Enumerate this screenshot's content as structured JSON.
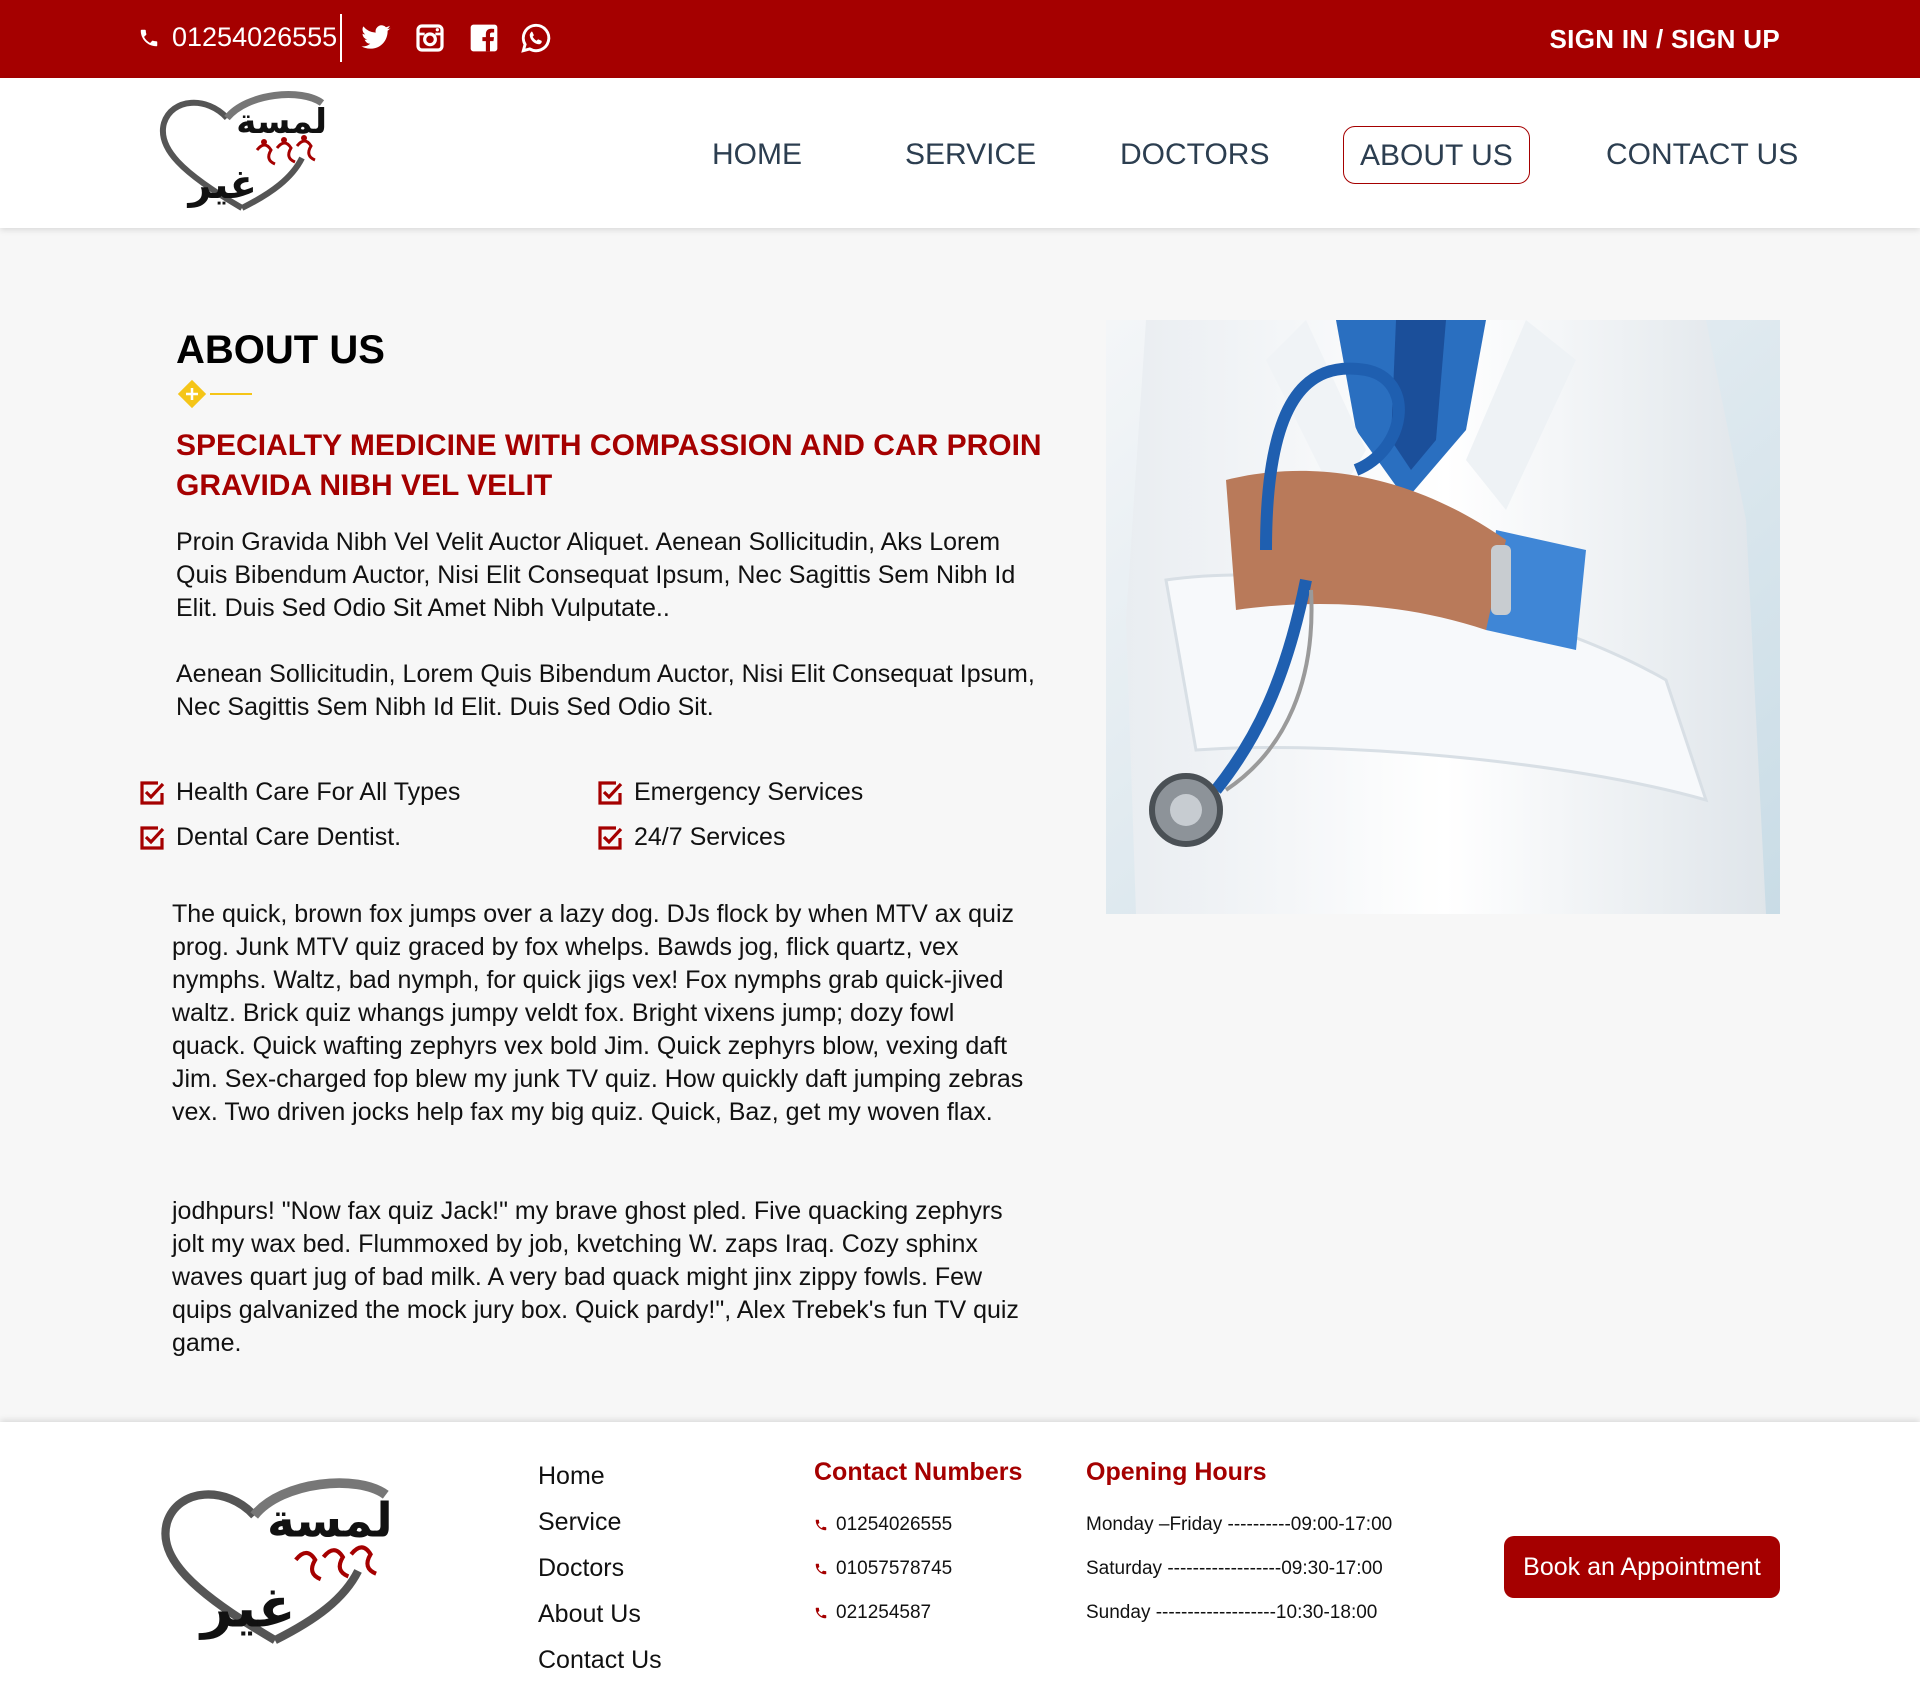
{
  "colors": {
    "brand": "#a50000",
    "accent": "#f5c518",
    "nav_text": "#2c3e50"
  },
  "topbar": {
    "phone": "01254026555",
    "phone_icon": "phone-icon",
    "social_icons": [
      "twitter-icon",
      "instagram-icon",
      "facebook-icon",
      "whatsapp-icon"
    ],
    "auth_label": "SIGN IN / SIGN UP"
  },
  "nav": {
    "items": [
      {
        "label": "HOME"
      },
      {
        "label": "SERVICE"
      },
      {
        "label": "DOCTORS"
      },
      {
        "label": "ABOUT US",
        "active": true
      },
      {
        "label": "CONTACT US"
      }
    ]
  },
  "logo": {
    "text_line1": "لمسة",
    "text_line2": "غير"
  },
  "about": {
    "title": "ABOUT US",
    "subheading": "SPECIALTY MEDICINE WITH COMPASSION AND CAR PROIN GRAVIDA NIBH VEL VELIT",
    "paragraph1": "Proin Gravida Nibh Vel Velit Auctor Aliquet. Aenean Sollicitudin, Aks Lorem Quis Bibendum Auctor, Nisi Elit Consequat Ipsum, Nec Sagittis Sem Nibh Id Elit. Duis Sed Odio Sit Amet Nibh Vulputate..",
    "paragraph2": "Aenean Sollicitudin, Lorem Quis Bibendum Auctor, Nisi Elit Consequat Ipsum, Nec Sagittis Sem Nibh Id Elit. Duis Sed Odio Sit.",
    "features": [
      "Health Care For All Types",
      "Emergency Services",
      "Dental Care Dentist.",
      "24/7 Services"
    ],
    "paragraph3": "The quick, brown fox jumps over a lazy dog. DJs flock by when MTV ax quiz prog. Junk MTV quiz graced by fox whelps. Bawds jog, flick quartz, vex nymphs. Waltz, bad nymph, for quick jigs vex! Fox nymphs grab quick-jived waltz. Brick quiz whangs jumpy veldt fox. Bright vixens jump; dozy fowl quack. Quick wafting zephyrs vex bold Jim. Quick zephyrs blow, vexing daft Jim. Sex-charged fop blew my junk TV quiz. How quickly daft jumping zebras vex. Two driven jocks help fax my big quiz. Quick, Baz, get my woven flax.",
    "paragraph4": "jodhpurs! \"Now fax quiz Jack!\" my brave ghost pled. Five quacking zephyrs jolt my wax bed. Flummoxed by job, kvetching W. zaps Iraq. Cozy sphinx waves quart jug of bad milk. A very bad quack might jinx zippy fowls. Few quips galvanized the mock jury box. Quick pardy!\", Alex Trebek's fun TV quiz game."
  },
  "footer": {
    "links": [
      "Home",
      "Service",
      "Doctors",
      "About Us",
      "Contact Us"
    ],
    "contact_heading": "Contact Numbers",
    "phones": [
      "01254026555",
      "01057578745",
      "021254587"
    ],
    "hours_heading": "Opening Hours",
    "hours": [
      "Monday –Friday ----------09:00-17:00",
      "Saturday ------------------09:30-17:00",
      "Sunday -------------------10:30-18:00"
    ],
    "book_label": "Book an Appointment"
  }
}
